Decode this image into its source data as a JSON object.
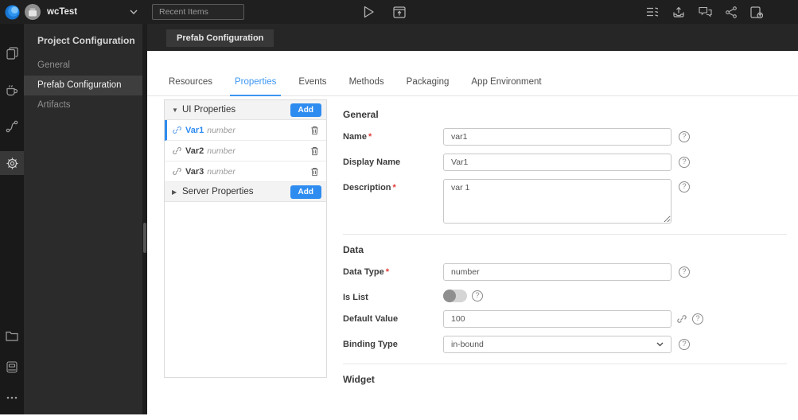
{
  "app": {
    "project_name": "wcTest",
    "recent_items_placeholder": "Recent Items"
  },
  "topbar_icons": [
    "wavemaker-logo",
    "project-avatar",
    "chevron-down",
    "run-play",
    "preview-window",
    "structure-list",
    "publish-upload",
    "feedback-chat",
    "share-branch",
    "export-file"
  ],
  "rail_icons": [
    "pages",
    "java-services",
    "api-flow",
    "settings-gear",
    "folder",
    "database",
    "more-dots"
  ],
  "sidebar": {
    "title": "Project Configuration",
    "items": [
      {
        "label": "General"
      },
      {
        "label": "Prefab Configuration"
      },
      {
        "label": "Artifacts"
      }
    ]
  },
  "main": {
    "top_tab": "Prefab Configuration",
    "tabs": [
      {
        "label": "Resources"
      },
      {
        "label": "Properties"
      },
      {
        "label": "Events"
      },
      {
        "label": "Methods"
      },
      {
        "label": "Packaging"
      },
      {
        "label": "App Environment"
      }
    ],
    "properties_list": {
      "ui_group": {
        "label": "UI Properties",
        "add_label": "Add"
      },
      "server_group": {
        "label": "Server Properties",
        "add_label": "Add"
      },
      "items": [
        {
          "name": "Var1",
          "type": "number"
        },
        {
          "name": "Var2",
          "type": "number"
        },
        {
          "name": "Var3",
          "type": "number"
        }
      ]
    },
    "form": {
      "general": {
        "title": "General",
        "name": {
          "label": "Name",
          "value": "var1"
        },
        "display_name": {
          "label": "Display Name",
          "value": "Var1"
        },
        "description": {
          "label": "Description",
          "value": "var 1"
        }
      },
      "data": {
        "title": "Data",
        "data_type": {
          "label": "Data Type",
          "value": "number"
        },
        "is_list": {
          "label": "Is List",
          "state": "off"
        },
        "default_value": {
          "label": "Default Value",
          "value": "100"
        },
        "binding_type": {
          "label": "Binding Type",
          "value": "in-bound"
        }
      },
      "widget": {
        "title": "Widget"
      }
    }
  },
  "colors": {
    "accent_blue": "#2e8cf0",
    "tab_active_blue": "#3d96f2",
    "topbar_bg": "#1f1f1f",
    "rail_bg": "#191919",
    "panel_bg": "#2b2b2b",
    "selected_item_bg": "#3e3e3e",
    "band_bg": "#262626",
    "required_red": "#e23b3b"
  }
}
